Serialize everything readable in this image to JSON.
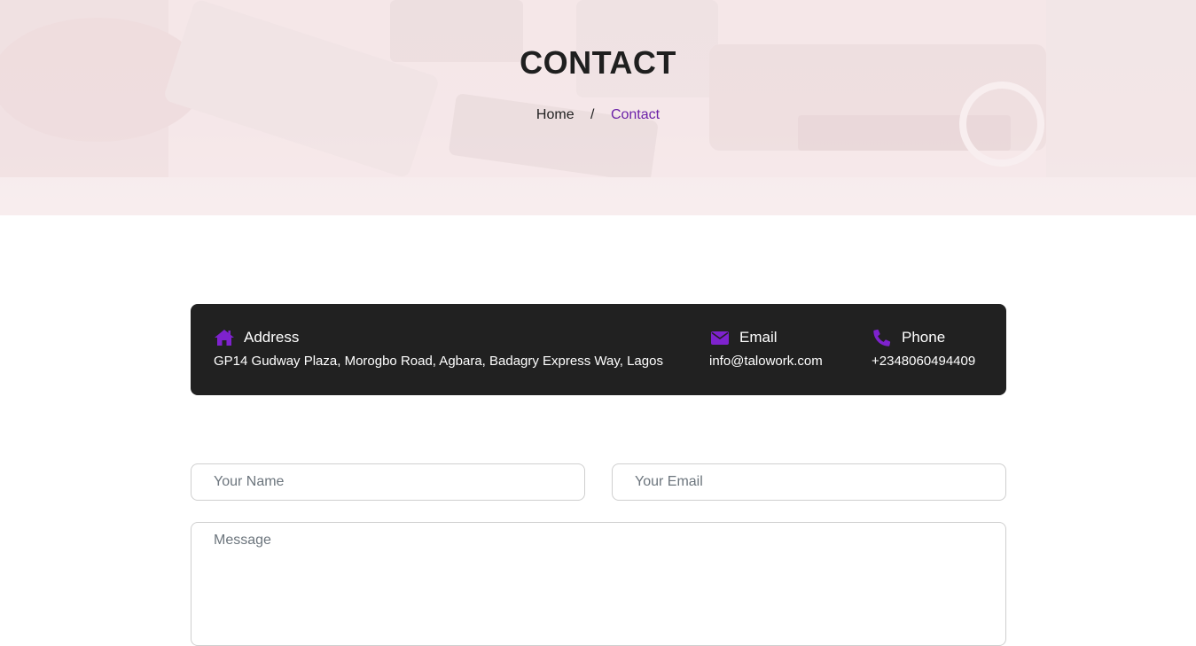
{
  "hero": {
    "title": "CONTACT",
    "breadcrumb": {
      "home": "Home",
      "separator": "/",
      "current": "Contact"
    }
  },
  "contact_info": {
    "address": {
      "icon": "home-icon",
      "label": "Address",
      "value": "GP14 Gudway Plaza, Morogbo Road, Agbara, Badagry Express Way, Lagos"
    },
    "email": {
      "icon": "envelope-icon",
      "label": "Email",
      "value": "info@talowork.com"
    },
    "phone": {
      "icon": "phone-icon",
      "label": "Phone",
      "value": "+2348060494409"
    }
  },
  "form": {
    "name_placeholder": "Your Name",
    "email_placeholder": "Your Email",
    "message_placeholder": "Message"
  },
  "colors": {
    "accent": "#6b21a8",
    "info_bar_bg": "#212121",
    "hero_tint": "#f7ebec"
  }
}
